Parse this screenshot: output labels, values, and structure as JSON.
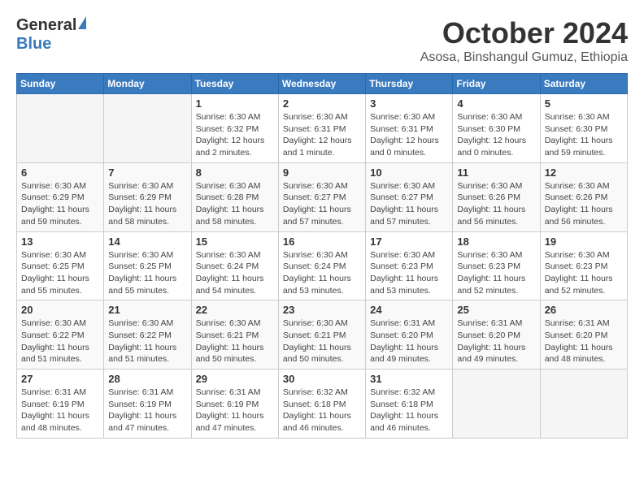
{
  "header": {
    "logo_general": "General",
    "logo_blue": "Blue",
    "month_title": "October 2024",
    "subtitle": "Asosa, Binshangul Gumuz, Ethiopia"
  },
  "days_of_week": [
    "Sunday",
    "Monday",
    "Tuesday",
    "Wednesday",
    "Thursday",
    "Friday",
    "Saturday"
  ],
  "weeks": [
    [
      {
        "day": "",
        "info": ""
      },
      {
        "day": "",
        "info": ""
      },
      {
        "day": "1",
        "info": "Sunrise: 6:30 AM\nSunset: 6:32 PM\nDaylight: 12 hours and 2 minutes."
      },
      {
        "day": "2",
        "info": "Sunrise: 6:30 AM\nSunset: 6:31 PM\nDaylight: 12 hours and 1 minute."
      },
      {
        "day": "3",
        "info": "Sunrise: 6:30 AM\nSunset: 6:31 PM\nDaylight: 12 hours and 0 minutes."
      },
      {
        "day": "4",
        "info": "Sunrise: 6:30 AM\nSunset: 6:30 PM\nDaylight: 12 hours and 0 minutes."
      },
      {
        "day": "5",
        "info": "Sunrise: 6:30 AM\nSunset: 6:30 PM\nDaylight: 11 hours and 59 minutes."
      }
    ],
    [
      {
        "day": "6",
        "info": "Sunrise: 6:30 AM\nSunset: 6:29 PM\nDaylight: 11 hours and 59 minutes."
      },
      {
        "day": "7",
        "info": "Sunrise: 6:30 AM\nSunset: 6:29 PM\nDaylight: 11 hours and 58 minutes."
      },
      {
        "day": "8",
        "info": "Sunrise: 6:30 AM\nSunset: 6:28 PM\nDaylight: 11 hours and 58 minutes."
      },
      {
        "day": "9",
        "info": "Sunrise: 6:30 AM\nSunset: 6:27 PM\nDaylight: 11 hours and 57 minutes."
      },
      {
        "day": "10",
        "info": "Sunrise: 6:30 AM\nSunset: 6:27 PM\nDaylight: 11 hours and 57 minutes."
      },
      {
        "day": "11",
        "info": "Sunrise: 6:30 AM\nSunset: 6:26 PM\nDaylight: 11 hours and 56 minutes."
      },
      {
        "day": "12",
        "info": "Sunrise: 6:30 AM\nSunset: 6:26 PM\nDaylight: 11 hours and 56 minutes."
      }
    ],
    [
      {
        "day": "13",
        "info": "Sunrise: 6:30 AM\nSunset: 6:25 PM\nDaylight: 11 hours and 55 minutes."
      },
      {
        "day": "14",
        "info": "Sunrise: 6:30 AM\nSunset: 6:25 PM\nDaylight: 11 hours and 55 minutes."
      },
      {
        "day": "15",
        "info": "Sunrise: 6:30 AM\nSunset: 6:24 PM\nDaylight: 11 hours and 54 minutes."
      },
      {
        "day": "16",
        "info": "Sunrise: 6:30 AM\nSunset: 6:24 PM\nDaylight: 11 hours and 53 minutes."
      },
      {
        "day": "17",
        "info": "Sunrise: 6:30 AM\nSunset: 6:23 PM\nDaylight: 11 hours and 53 minutes."
      },
      {
        "day": "18",
        "info": "Sunrise: 6:30 AM\nSunset: 6:23 PM\nDaylight: 11 hours and 52 minutes."
      },
      {
        "day": "19",
        "info": "Sunrise: 6:30 AM\nSunset: 6:23 PM\nDaylight: 11 hours and 52 minutes."
      }
    ],
    [
      {
        "day": "20",
        "info": "Sunrise: 6:30 AM\nSunset: 6:22 PM\nDaylight: 11 hours and 51 minutes."
      },
      {
        "day": "21",
        "info": "Sunrise: 6:30 AM\nSunset: 6:22 PM\nDaylight: 11 hours and 51 minutes."
      },
      {
        "day": "22",
        "info": "Sunrise: 6:30 AM\nSunset: 6:21 PM\nDaylight: 11 hours and 50 minutes."
      },
      {
        "day": "23",
        "info": "Sunrise: 6:30 AM\nSunset: 6:21 PM\nDaylight: 11 hours and 50 minutes."
      },
      {
        "day": "24",
        "info": "Sunrise: 6:31 AM\nSunset: 6:20 PM\nDaylight: 11 hours and 49 minutes."
      },
      {
        "day": "25",
        "info": "Sunrise: 6:31 AM\nSunset: 6:20 PM\nDaylight: 11 hours and 49 minutes."
      },
      {
        "day": "26",
        "info": "Sunrise: 6:31 AM\nSunset: 6:20 PM\nDaylight: 11 hours and 48 minutes."
      }
    ],
    [
      {
        "day": "27",
        "info": "Sunrise: 6:31 AM\nSunset: 6:19 PM\nDaylight: 11 hours and 48 minutes."
      },
      {
        "day": "28",
        "info": "Sunrise: 6:31 AM\nSunset: 6:19 PM\nDaylight: 11 hours and 47 minutes."
      },
      {
        "day": "29",
        "info": "Sunrise: 6:31 AM\nSunset: 6:19 PM\nDaylight: 11 hours and 47 minutes."
      },
      {
        "day": "30",
        "info": "Sunrise: 6:32 AM\nSunset: 6:18 PM\nDaylight: 11 hours and 46 minutes."
      },
      {
        "day": "31",
        "info": "Sunrise: 6:32 AM\nSunset: 6:18 PM\nDaylight: 11 hours and 46 minutes."
      },
      {
        "day": "",
        "info": ""
      },
      {
        "day": "",
        "info": ""
      }
    ]
  ]
}
